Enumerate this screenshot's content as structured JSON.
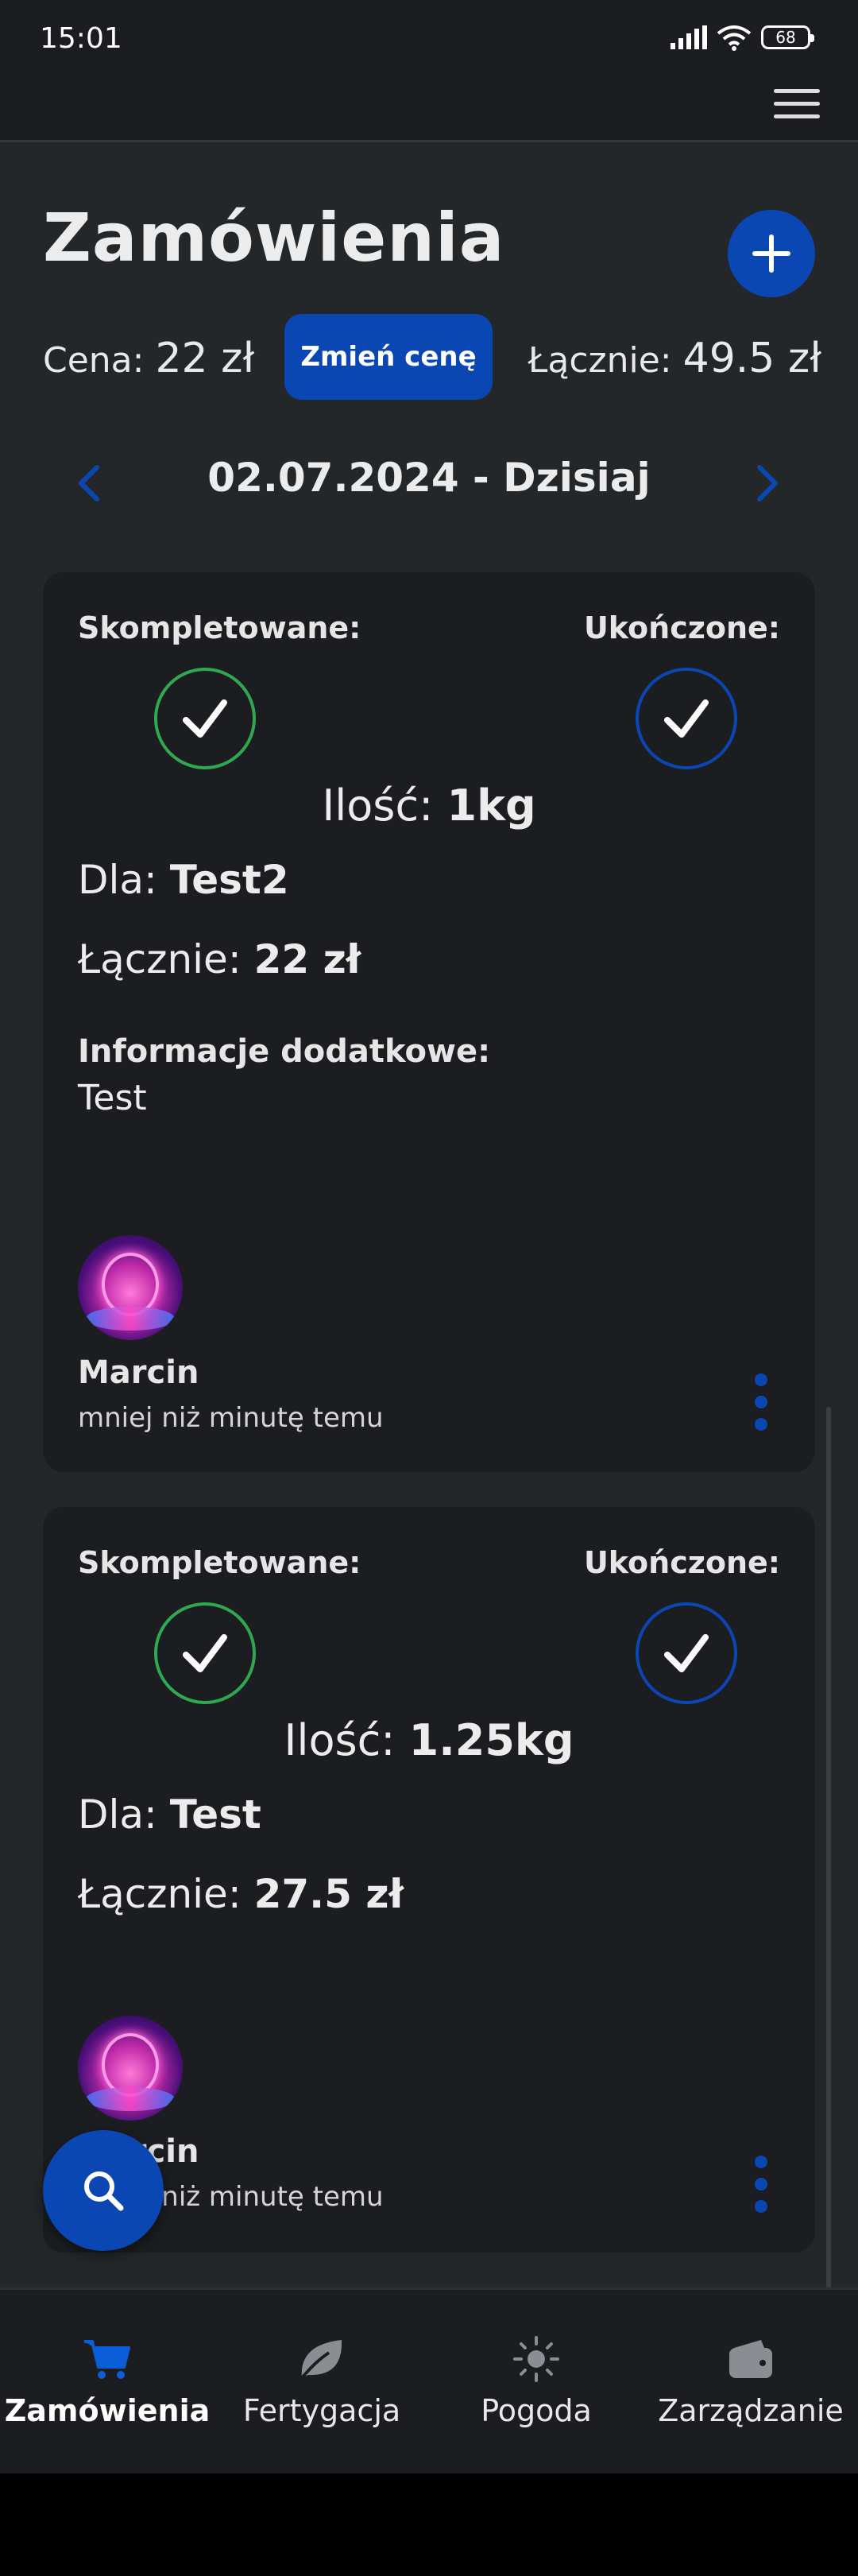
{
  "status_bar": {
    "time": "15:01",
    "battery": "68"
  },
  "header": {
    "title": "Zamówienia"
  },
  "price": {
    "price_label": "Cena:",
    "price_value": "22 zł",
    "change_button": "Zmień cenę",
    "total_label": "Łącznie:",
    "total_value": "49.5 zł"
  },
  "date_nav": {
    "date": "02.07.2024 - Dzisiaj"
  },
  "orders": [
    {
      "completed_label": "Skompletowane:",
      "finished_label": "Ukończone:",
      "qty_label": "Ilość:",
      "qty_value": "1kg",
      "for_label": "Dla:",
      "for_value": "Test2",
      "total_label": "Łącznie:",
      "total_value": "22 zł",
      "info_label": "Informacje dodatkowe:",
      "info_text": "Test",
      "user_name": "Marcin",
      "user_time": "mniej niż minutę temu"
    },
    {
      "completed_label": "Skompletowane:",
      "finished_label": "Ukończone:",
      "qty_label": "Ilość:",
      "qty_value": "1.25kg",
      "for_label": "Dla:",
      "for_value": "Test",
      "total_label": "Łącznie:",
      "total_value": "27.5 zł",
      "user_name": "Marcin",
      "user_time": "mniej niż minutę temu"
    }
  ],
  "bottom_nav": [
    {
      "label": "Zamówienia",
      "icon": "cart-icon",
      "active": true
    },
    {
      "label": "Fertygacja",
      "icon": "leaf-icon",
      "active": false
    },
    {
      "label": "Pogoda",
      "icon": "sun-icon",
      "active": false
    },
    {
      "label": "Zarządzanie",
      "icon": "wallet-icon",
      "active": false
    }
  ],
  "colors": {
    "accent": "#0b47b3",
    "green": "#2ea94f",
    "background": "#24272a",
    "card": "#1c1d20"
  }
}
